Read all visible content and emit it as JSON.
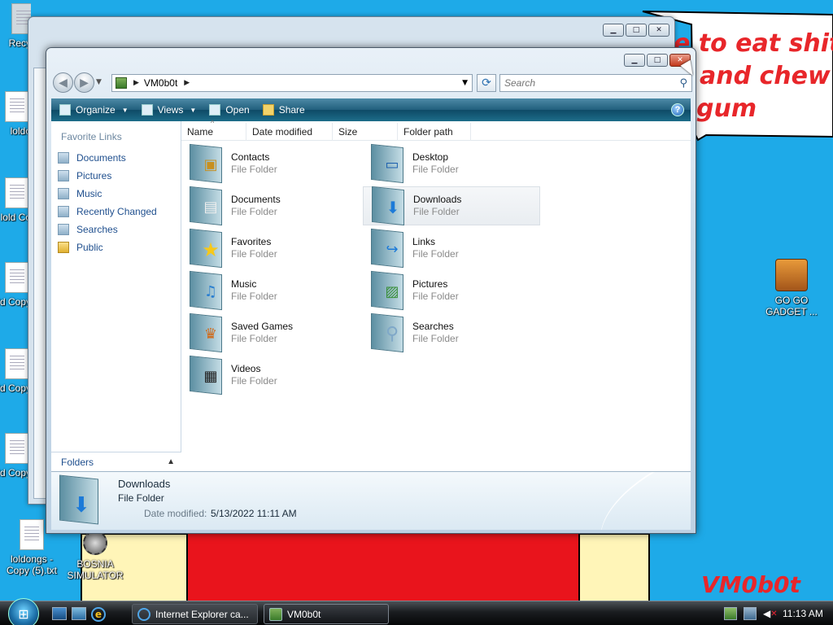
{
  "wallpaper": {
    "lines": [
      "e to eat shit",
      "and chew",
      "gum"
    ],
    "signature": "VM0b0t",
    "text_color": "#e8262a",
    "sky_color": "#1eaae8"
  },
  "desktop_icons": [
    {
      "label": "Recy",
      "icon": "recycle-bin-icon"
    },
    {
      "label": "loldo",
      "icon": "text-file-icon"
    },
    {
      "label": "lold Co",
      "icon": "text-file-icon"
    },
    {
      "label": "lold Copy",
      "icon": "text-file-icon"
    },
    {
      "label": "lold Copy",
      "icon": "text-file-icon"
    },
    {
      "label": "lold Copy",
      "icon": "text-file-icon"
    },
    {
      "label": "loldongs - Copy (5).txt",
      "icon": "text-file-icon"
    },
    {
      "label": "BOSNIA SIMULATOR",
      "icon": "shortcut-icon"
    },
    {
      "label": "GO GO GADGET ...",
      "icon": "briefcase-icon"
    }
  ],
  "explorer": {
    "breadcrumb": "VM0b0t",
    "search_placeholder": "Search",
    "toolbar": {
      "organize": "Organize",
      "views": "Views",
      "open": "Open",
      "share": "Share",
      "help": "?"
    },
    "favorite_links_title": "Favorite Links",
    "favorite_links": [
      "Documents",
      "Pictures",
      "Music",
      "Recently Changed",
      "Searches",
      "Public"
    ],
    "folders_label": "Folders",
    "columns": [
      "Name",
      "Date modified",
      "Size",
      "Folder path"
    ],
    "items": [
      {
        "name": "Contacts",
        "type": "File Folder",
        "icon": "contacts-folder-icon"
      },
      {
        "name": "Desktop",
        "type": "File Folder",
        "icon": "desktop-folder-icon"
      },
      {
        "name": "Documents",
        "type": "File Folder",
        "icon": "documents-folder-icon"
      },
      {
        "name": "Downloads",
        "type": "File Folder",
        "icon": "downloads-folder-icon",
        "selected": true
      },
      {
        "name": "Favorites",
        "type": "File Folder",
        "icon": "favorites-folder-icon"
      },
      {
        "name": "Links",
        "type": "File Folder",
        "icon": "links-folder-icon"
      },
      {
        "name": "Music",
        "type": "File Folder",
        "icon": "music-folder-icon"
      },
      {
        "name": "Pictures",
        "type": "File Folder",
        "icon": "pictures-folder-icon"
      },
      {
        "name": "Saved Games",
        "type": "File Folder",
        "icon": "saved-games-folder-icon"
      },
      {
        "name": "Searches",
        "type": "File Folder",
        "icon": "searches-folder-icon"
      },
      {
        "name": "Videos",
        "type": "File Folder",
        "icon": "videos-folder-icon"
      }
    ],
    "details": {
      "name": "Downloads",
      "type": "File Folder",
      "date_label": "Date modified:",
      "date_value": "5/13/2022 11:11 AM"
    }
  },
  "taskbar": {
    "tasks": [
      {
        "label": "Internet Explorer ca...",
        "icon": "internet-explorer-icon"
      },
      {
        "label": "VM0b0t",
        "icon": "folder-icon",
        "active": true
      }
    ],
    "clock": "11:13 AM"
  }
}
